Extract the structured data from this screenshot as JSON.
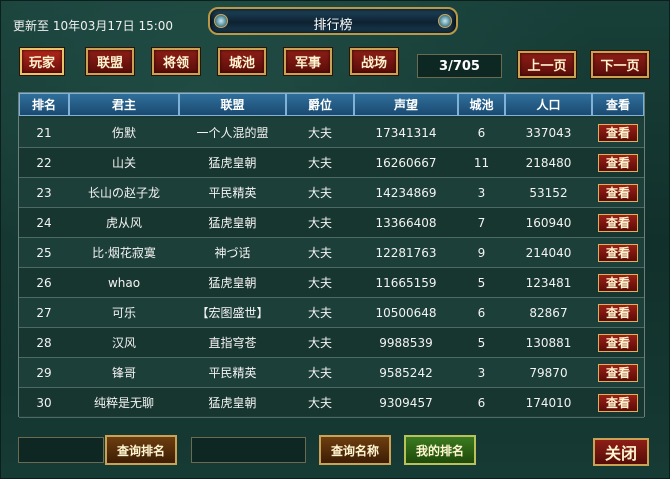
{
  "header": {
    "updated": "更新至 10年03月17日 15:00",
    "title": "排行榜"
  },
  "tabs": [
    {
      "label": "玩家",
      "active": true
    },
    {
      "label": "联盟",
      "active": false
    },
    {
      "label": "将领",
      "active": false
    },
    {
      "label": "城池",
      "active": false
    },
    {
      "label": "军事",
      "active": false
    },
    {
      "label": "战场",
      "active": false
    }
  ],
  "pagination": {
    "indicator": "3/705",
    "prev_label": "上一页",
    "next_label": "下一页"
  },
  "table": {
    "columns": [
      "排名",
      "君主",
      "联盟",
      "爵位",
      "声望",
      "城池",
      "人口",
      "查看"
    ],
    "view_label": "查看",
    "rows": [
      {
        "rank": "21",
        "lord": "伤默",
        "alliance": "一个人混的盟",
        "title": "大夫",
        "prestige": "17341314",
        "cities": "6",
        "population": "337043"
      },
      {
        "rank": "22",
        "lord": "山关",
        "alliance": "猛虎皇朝",
        "title": "大夫",
        "prestige": "16260667",
        "cities": "11",
        "population": "218480"
      },
      {
        "rank": "23",
        "lord": "长山の赵子龙",
        "alliance": "平民精英",
        "title": "大夫",
        "prestige": "14234869",
        "cities": "3",
        "population": "53152"
      },
      {
        "rank": "24",
        "lord": "虎从风",
        "alliance": "猛虎皇朝",
        "title": "大夫",
        "prestige": "13366408",
        "cities": "7",
        "population": "160940"
      },
      {
        "rank": "25",
        "lord": "比·烟花寂寞",
        "alliance": "神づ话",
        "title": "大夫",
        "prestige": "12281763",
        "cities": "9",
        "population": "214040"
      },
      {
        "rank": "26",
        "lord": "whao",
        "alliance": "猛虎皇朝",
        "title": "大夫",
        "prestige": "11665159",
        "cities": "5",
        "population": "123481"
      },
      {
        "rank": "27",
        "lord": "可乐",
        "alliance": "【宏图盛世】",
        "title": "大夫",
        "prestige": "10500648",
        "cities": "6",
        "population": "82867"
      },
      {
        "rank": "28",
        "lord": "汉风",
        "alliance": "直指穹苍",
        "title": "大夫",
        "prestige": "9988539",
        "cities": "5",
        "population": "130881"
      },
      {
        "rank": "29",
        "lord": "锋哥",
        "alliance": "平民精英",
        "title": "大夫",
        "prestige": "9585242",
        "cities": "3",
        "population": "79870"
      },
      {
        "rank": "30",
        "lord": "纯粹是无聊",
        "alliance": "猛虎皇朝",
        "title": "大夫",
        "prestige": "9309457",
        "cities": "6",
        "population": "174010"
      }
    ]
  },
  "footer": {
    "rank_input_value": "",
    "search_rank_label": "查询排名",
    "name_input_value": "",
    "search_name_label": "查询名称",
    "my_rank_label": "我的排名",
    "close_label": "关闭"
  }
}
